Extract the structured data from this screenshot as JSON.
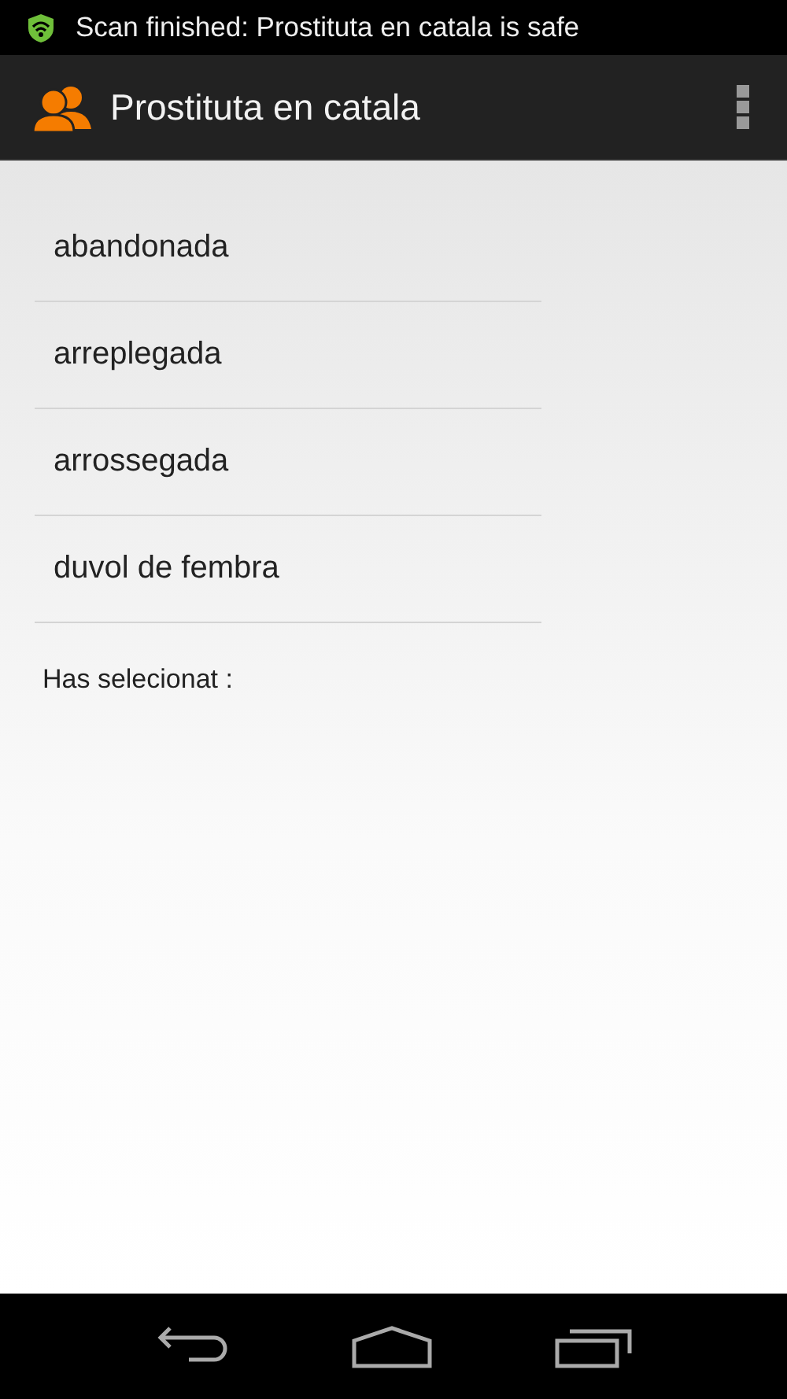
{
  "status_bar": {
    "notification": "Scan finished: Prostituta en catala is safe"
  },
  "action_bar": {
    "title": "Prostituta en catala"
  },
  "list": {
    "items": [
      {
        "label": "abandonada"
      },
      {
        "label": "arreplegada"
      },
      {
        "label": "arrossegada"
      },
      {
        "label": "duvol de fembra"
      }
    ]
  },
  "selection_label": "Has selecionat :"
}
